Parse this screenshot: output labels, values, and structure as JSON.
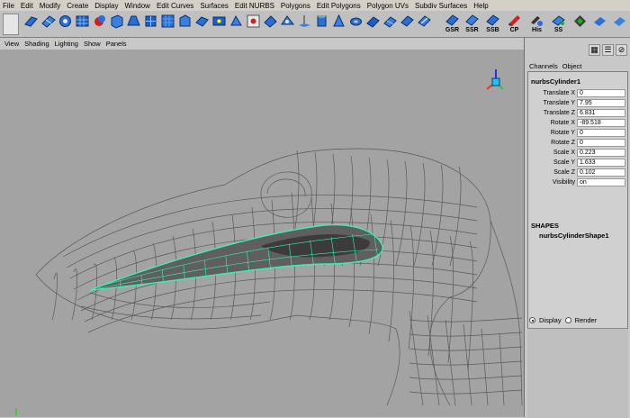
{
  "menubar": {
    "items": [
      "File",
      "Edit",
      "Modify",
      "Create",
      "Display",
      "Window",
      "Edit Curves",
      "Surfaces",
      "Edit NURBS",
      "Polygons",
      "Edit Polygons",
      "Polygon UVs",
      "Subdiv Surfaces",
      "Help"
    ]
  },
  "shelf": {
    "labels": {
      "gsr": "GSR",
      "ssr": "SSR",
      "ssb": "SSB",
      "cp": "CP",
      "his": "His",
      "ss": "SS"
    }
  },
  "viewport": {
    "menu": [
      "View",
      "Shading",
      "Lighting",
      "Show",
      "Panels"
    ]
  },
  "channel_box": {
    "tabs": [
      "Channels",
      "Object"
    ],
    "object_name": "nurbsCylinder1",
    "attributes": [
      {
        "label": "Translate X",
        "value": "0"
      },
      {
        "label": "Translate Y",
        "value": "7.95"
      },
      {
        "label": "Translate Z",
        "value": "6.831"
      },
      {
        "label": "Rotate X",
        "value": "-89.518"
      },
      {
        "label": "Rotate Y",
        "value": "0"
      },
      {
        "label": "Rotate Z",
        "value": "0"
      },
      {
        "label": "Scale X",
        "value": "0.223"
      },
      {
        "label": "Scale Y",
        "value": "1.633"
      },
      {
        "label": "Scale Z",
        "value": "0.102"
      },
      {
        "label": "Visibility",
        "value": "on"
      }
    ],
    "shapes_header": "SHAPES",
    "shape_name": "nurbsCylinderShape1"
  },
  "layer_editor": {
    "display_label": "Display",
    "render_label": "Render"
  },
  "colors": {
    "wireframe": "#5a5a5a",
    "selected": "#3cf0b4",
    "viewport_bg": "#a3a3a3"
  }
}
